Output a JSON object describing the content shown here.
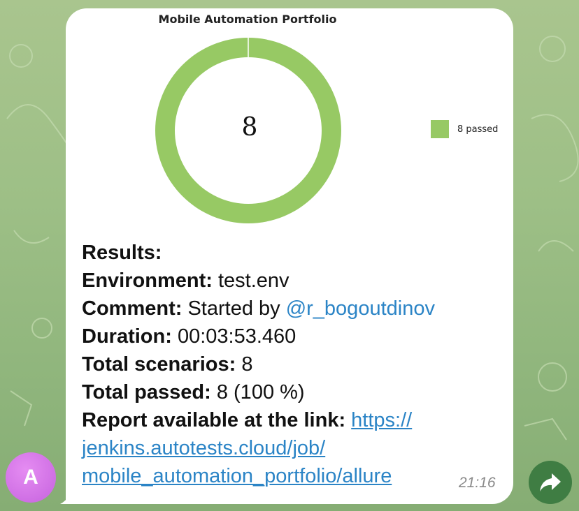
{
  "chart_data": {
    "type": "pie",
    "title": "Mobile Automation Portfolio",
    "center_label": "8",
    "categories": [
      "8 passed"
    ],
    "values": [
      8
    ],
    "colors": [
      "#97c964"
    ],
    "legend_position": "right"
  },
  "message": {
    "results_label": "Results:",
    "environment_label": "Environment:",
    "environment_value": "test.env",
    "comment_label": "Comment:",
    "comment_prefix": "Started by",
    "comment_user": "@r_bogoutdinov",
    "duration_label": "Duration:",
    "duration_value": "00:03:53.460",
    "total_scenarios_label": "Total scenarios:",
    "total_scenarios_value": "8",
    "total_passed_label": "Total passed:",
    "total_passed_value": "8 (100 %)",
    "report_label": "Report available at the link:",
    "report_link_line1": "https://",
    "report_link_line2": "jenkins.autotests.cloud/job/",
    "report_link_line3": "mobile_automation_portfolio/allure",
    "time": "21:16"
  },
  "avatar": {
    "initial": "A"
  },
  "icons": {
    "share": "share-icon"
  }
}
